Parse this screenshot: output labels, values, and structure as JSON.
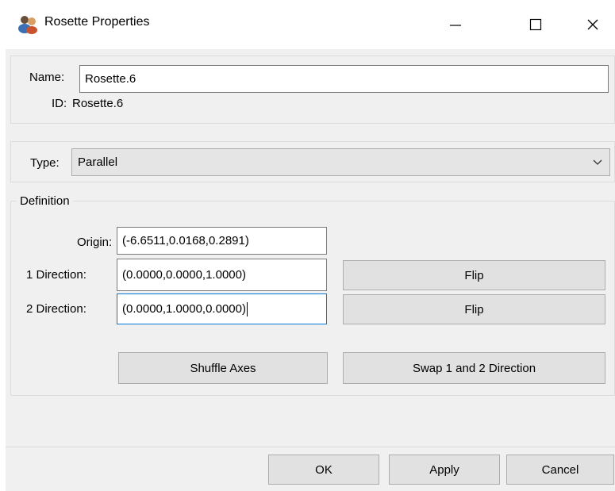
{
  "window": {
    "title": "Rosette Properties",
    "icon": "rosette-app-icon",
    "controls": {
      "minimize": "—",
      "maximize": "☐",
      "close": "✕"
    }
  },
  "identity": {
    "name_label": "Name:",
    "name_value": "Rosette.6",
    "id_label": "ID:",
    "id_value": "Rosette.6"
  },
  "type": {
    "label": "Type:",
    "selected": "Parallel",
    "dropdown_icon": "chevron-down-icon"
  },
  "definition": {
    "legend": "Definition",
    "origin_label": "Origin:",
    "origin_value": "(-6.6511,0.0168,0.2891)",
    "dir1_label": "1 Direction:",
    "dir1_value": "(0.0000,0.0000,1.0000)",
    "dir2_label": "2 Direction:",
    "dir2_value": "(0.0000,1.0000,0.0000)",
    "flip1_label": "Flip",
    "flip2_label": "Flip",
    "shuffle_label": "Shuffle Axes",
    "swap_label": "Swap 1 and 2 Direction"
  },
  "footer": {
    "ok_label": "OK",
    "apply_label": "Apply",
    "cancel_label": "Cancel"
  }
}
